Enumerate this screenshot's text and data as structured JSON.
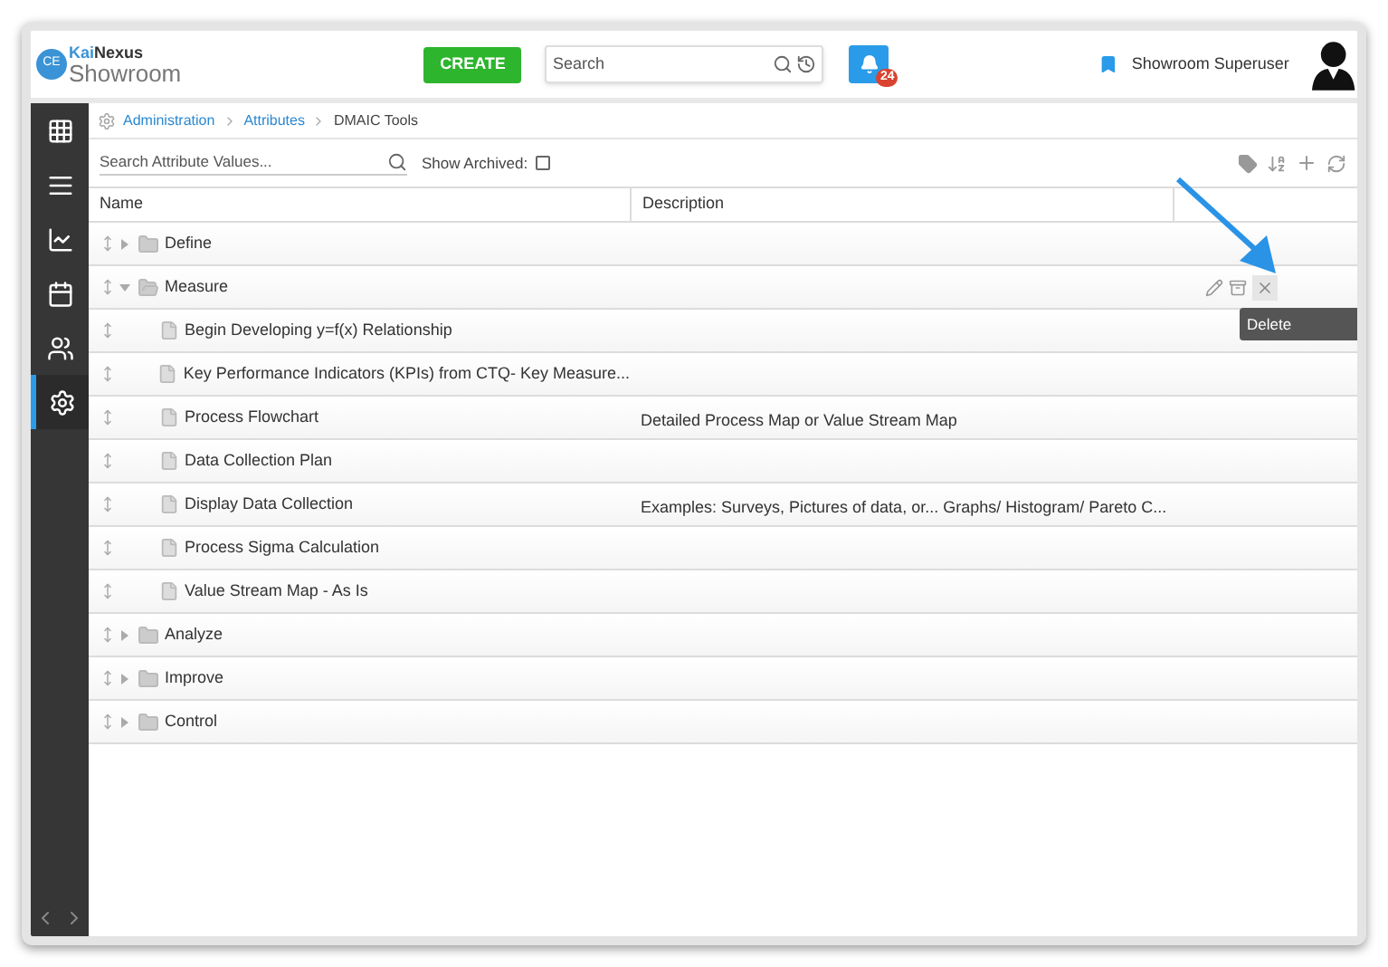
{
  "app": {
    "logo_initials": "CE",
    "brand_prefix": "Kai",
    "brand_name": "Nexus",
    "workspace": "Showroom"
  },
  "header": {
    "create_button": "CREATE",
    "search": {
      "placeholder": "Search"
    },
    "notifications": {
      "count": "24"
    },
    "user_name": "Showroom Superuser"
  },
  "sidebar": {
    "items": [
      {
        "kind": "grid",
        "selected": false
      },
      {
        "kind": "list",
        "selected": false
      },
      {
        "kind": "chart",
        "selected": false
      },
      {
        "kind": "calendar",
        "selected": false
      },
      {
        "kind": "people",
        "selected": false
      },
      {
        "kind": "settings",
        "selected": true
      }
    ]
  },
  "breadcrumb": [
    {
      "label": "Administration",
      "link": true
    },
    {
      "label": "Attributes",
      "link": true
    },
    {
      "label": "DMAIC Tools",
      "link": false
    }
  ],
  "toolbar": {
    "search": {
      "placeholder": "Search Attribute Values..."
    },
    "show_archived": {
      "label": "Show Archived:",
      "checked": false
    }
  },
  "table": {
    "columns": [
      "Name",
      "Description"
    ],
    "rows": [
      {
        "name": "Define",
        "kind": "folder",
        "expanded": false
      },
      {
        "name": "Measure",
        "kind": "folder",
        "expanded": true,
        "hovered": true,
        "children": [
          {
            "name": "Begin Developing y=f(x) Relationship",
            "kind": "file"
          },
          {
            "name": "Key Performance Indicators (KPIs) from CTQ- Key Measure...",
            "kind": "file"
          },
          {
            "name": "Process Flowchart",
            "kind": "file",
            "description": "Detailed Process Map or Value Stream Map"
          },
          {
            "name": "Data Collection Plan",
            "kind": "file"
          },
          {
            "name": "Display Data Collection",
            "kind": "file",
            "description": "Examples: Surveys, Pictures of data, or... Graphs/ Histogram/ Pareto C..."
          },
          {
            "name": "Process Sigma Calculation",
            "kind": "file"
          },
          {
            "name": "Value Stream Map - As Is",
            "kind": "file"
          }
        ]
      },
      {
        "name": "Analyze",
        "kind": "folder",
        "expanded": false
      },
      {
        "name": "Improve",
        "kind": "folder",
        "expanded": false
      },
      {
        "name": "Control",
        "kind": "folder",
        "expanded": false
      }
    ]
  },
  "tooltip": {
    "text": "Delete"
  }
}
